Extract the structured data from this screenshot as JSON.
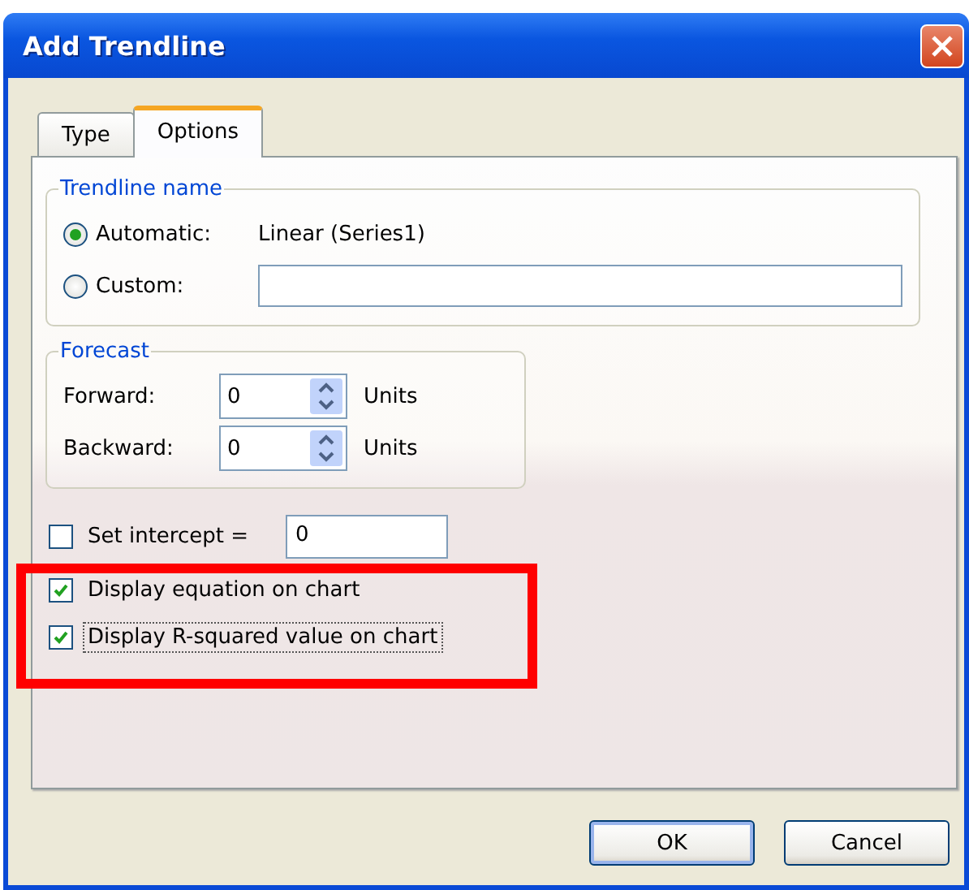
{
  "window": {
    "title": "Add Trendline"
  },
  "tabs": [
    {
      "label": "Type",
      "selected": false
    },
    {
      "label": "Options",
      "selected": true
    }
  ],
  "trendline_name": {
    "legend": "Trendline name",
    "options": [
      {
        "label": "Automatic:",
        "selected": true,
        "kind": "text",
        "value": "Linear (Series1)"
      },
      {
        "label": "Custom:",
        "selected": false,
        "kind": "field"
      }
    ]
  },
  "forecast": {
    "legend": "Forecast",
    "rows": [
      {
        "label": "Forward:",
        "value": "0",
        "unit": "Units"
      },
      {
        "label": "Backward:",
        "value": "0",
        "unit": "Units"
      }
    ]
  },
  "checkboxes": [
    {
      "label": "Set intercept =",
      "checked": false,
      "value": "0",
      "focused": false
    },
    {
      "label": "Display equation on chart",
      "checked": true,
      "focused": false
    },
    {
      "label": "Display R-squared value on chart",
      "checked": true,
      "focused": true
    }
  ],
  "buttons": [
    {
      "label": "OK",
      "kind": "default"
    },
    {
      "label": "Cancel",
      "kind": "normal"
    }
  ],
  "annotations": [
    {
      "kind": "highlight-box"
    }
  ]
}
